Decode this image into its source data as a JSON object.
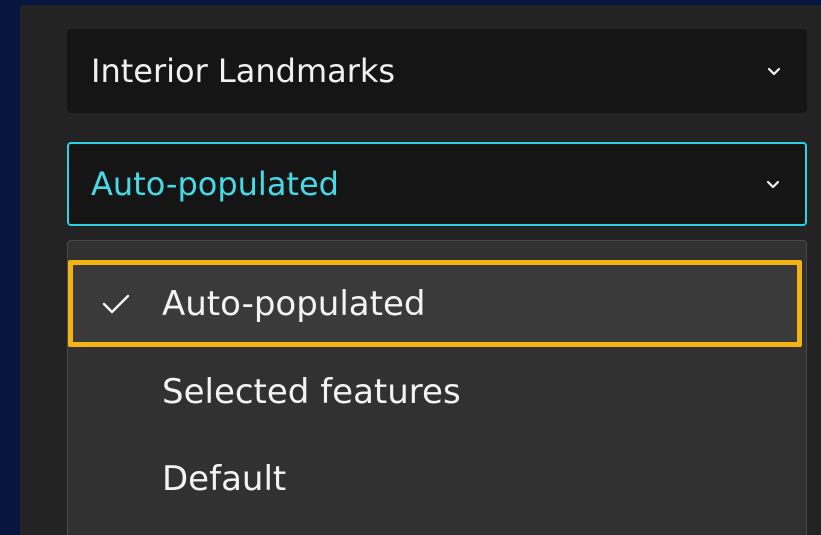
{
  "layer_dropdown": {
    "value": "Interior Landmarks",
    "icon": "chevron-down-icon"
  },
  "mode_dropdown": {
    "value": "Auto-populated",
    "icon": "chevron-down-icon",
    "accent_color": "#2ad3df"
  },
  "menu": {
    "items": [
      {
        "label": "Auto-populated",
        "selected": true,
        "icon": "check-icon"
      },
      {
        "label": "Selected features",
        "selected": false
      },
      {
        "label": "Default",
        "selected": false
      }
    ],
    "highlight_color": "#f3b313"
  },
  "colors": {
    "background": "#08153f",
    "panel": "#232323",
    "menu": "#313131",
    "text": "#f1f1f1"
  }
}
